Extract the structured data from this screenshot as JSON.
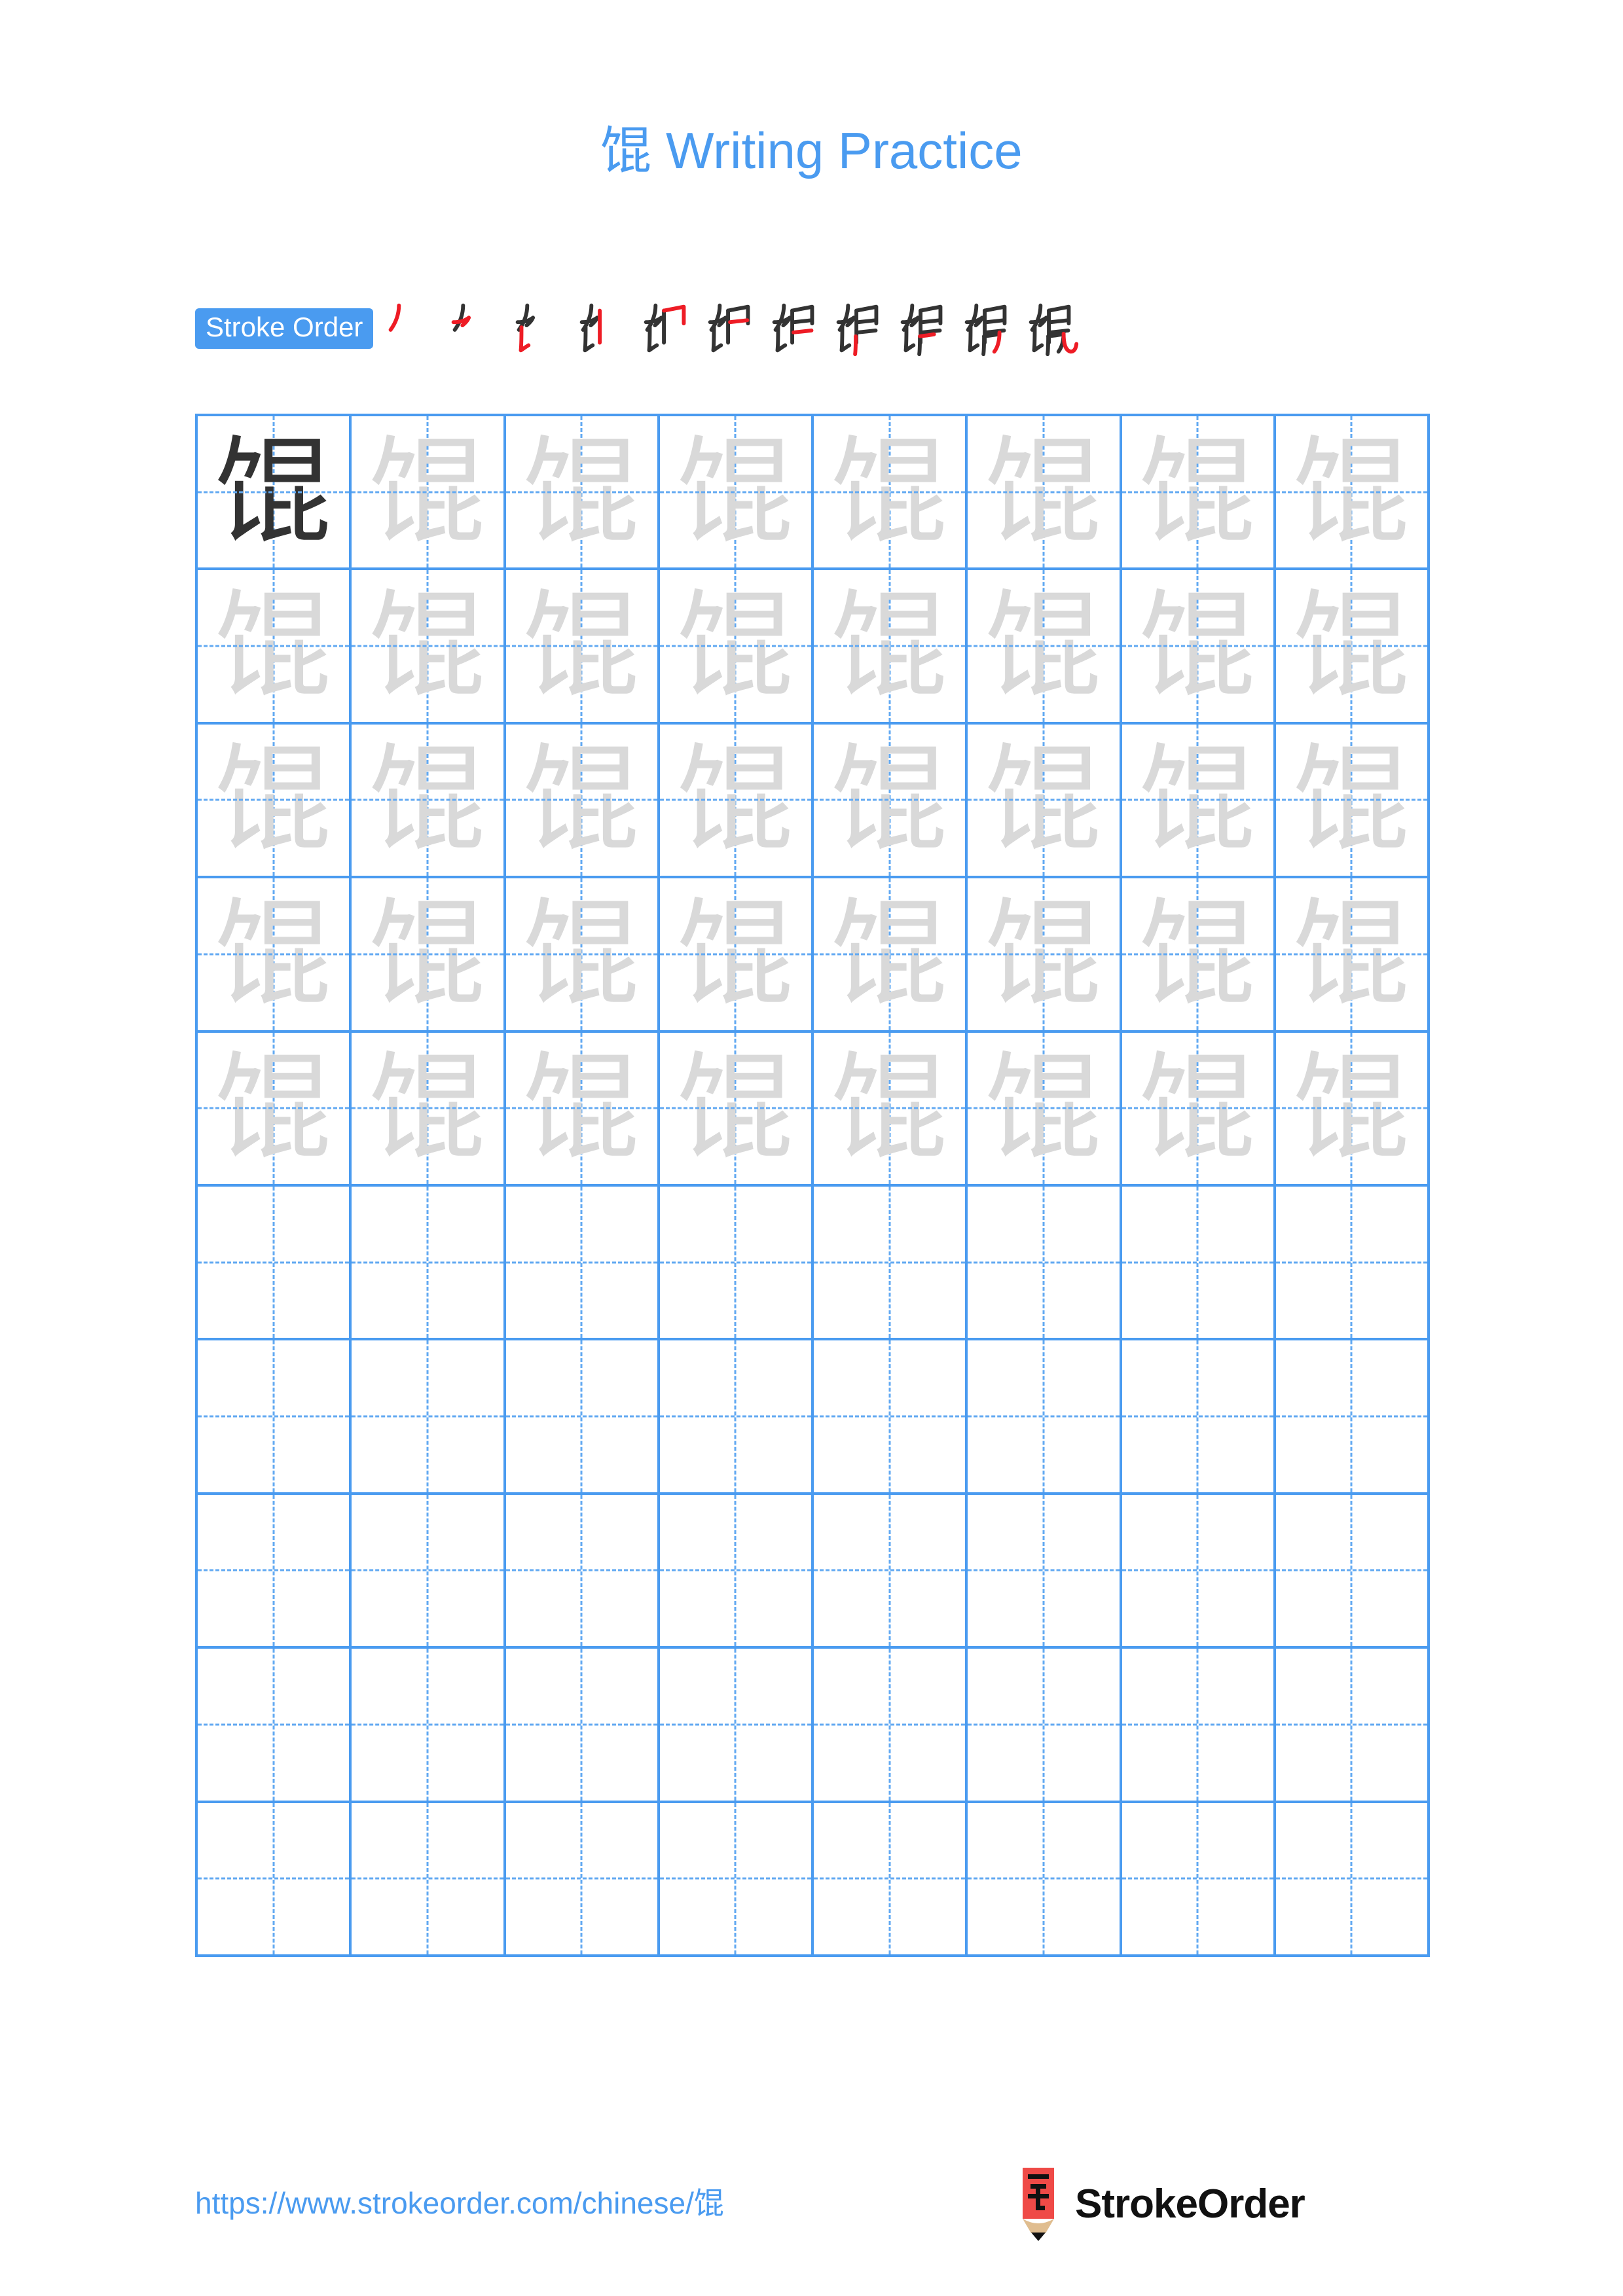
{
  "character": "馄",
  "header": {
    "title": "馄 Writing Practice"
  },
  "stroke_order": {
    "label": "Stroke Order",
    "total_strokes": 11,
    "steps": [
      {
        "index": 1,
        "new_stroke": "㇒ piě (left falling)"
      },
      {
        "index": 2,
        "new_stroke": "㇇ héng piě"
      },
      {
        "index": 3,
        "new_stroke": "㇙ shù tí"
      },
      {
        "index": 4,
        "new_stroke": "㇑ shù (vertical)"
      },
      {
        "index": 5,
        "new_stroke": "㇕ héng zhé"
      },
      {
        "index": 6,
        "new_stroke": "㇐ héng (horizontal)"
      },
      {
        "index": 7,
        "new_stroke": "㇐ héng (horizontal)"
      },
      {
        "index": 8,
        "new_stroke": "㇕ héng zhé"
      },
      {
        "index": 9,
        "new_stroke": "㇑ shù (vertical)"
      },
      {
        "index": 10,
        "new_stroke": "㇒ piě (left falling)"
      },
      {
        "index": 11,
        "new_stroke": "㇟ shù wān gōu"
      }
    ]
  },
  "grid": {
    "columns": 8,
    "rows": 10,
    "model_cell": {
      "row": 1,
      "col": 1,
      "style": "dark"
    },
    "trace_rows": 5,
    "blank_rows": 5
  },
  "footer": {
    "url": "https://www.strokeorder.com/chinese/馄",
    "brand_name": "StrokeOrder",
    "brand_mark_char": "字"
  },
  "colors": {
    "accent_blue": "#4a9bf0",
    "grid_line": "#4a9bf0",
    "guide_line": "#62a9f2",
    "model_ink": "#333333",
    "trace_ink": "#d9d9d9",
    "new_stroke_red": "#ee1c25",
    "brand_red": "#ef4a47",
    "brand_wood": "#e0bd8f"
  }
}
